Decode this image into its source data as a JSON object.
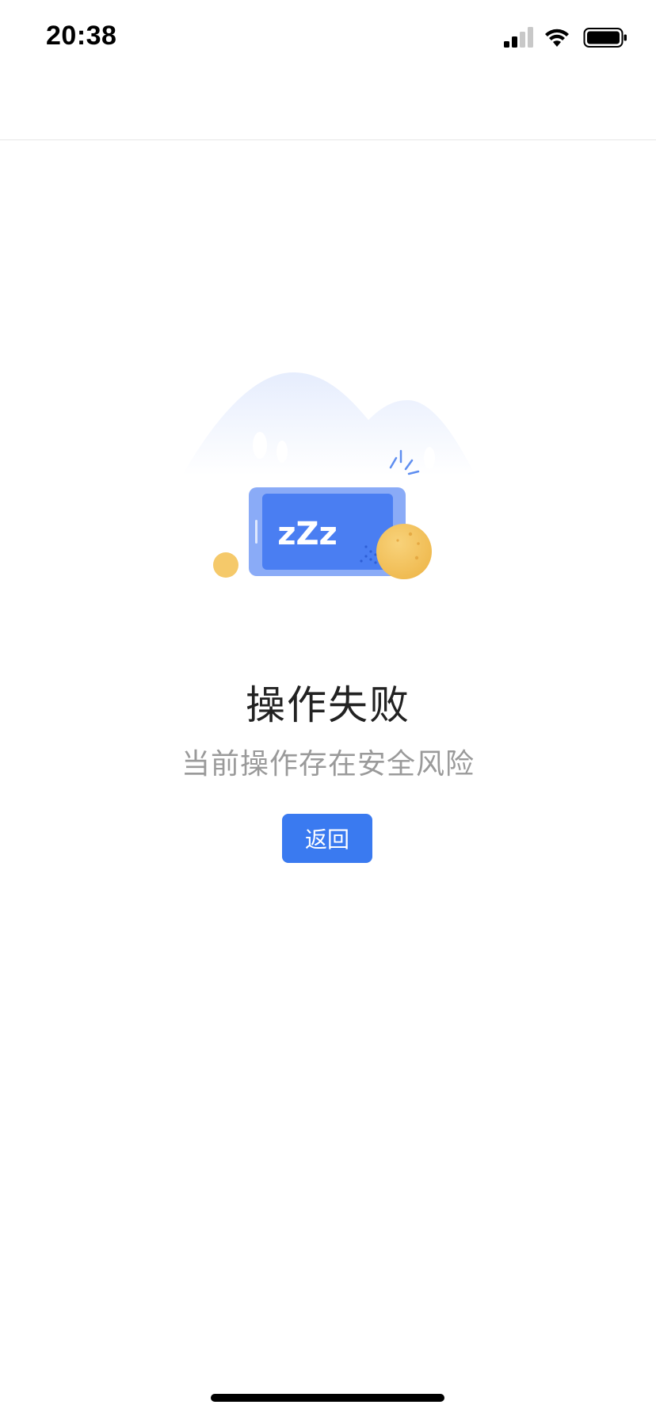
{
  "status_bar": {
    "time": "20:38",
    "icons": [
      "cellular-signal-icon",
      "wifi-icon",
      "battery-icon"
    ]
  },
  "result": {
    "illustration_text": "zZz",
    "title": "操作失败",
    "message": "当前操作存在安全风险",
    "back_label": "返回"
  },
  "colors": {
    "accent": "#3a7af0",
    "title": "#222222",
    "message": "#9a9a9a",
    "coin": "#f5c96a"
  }
}
